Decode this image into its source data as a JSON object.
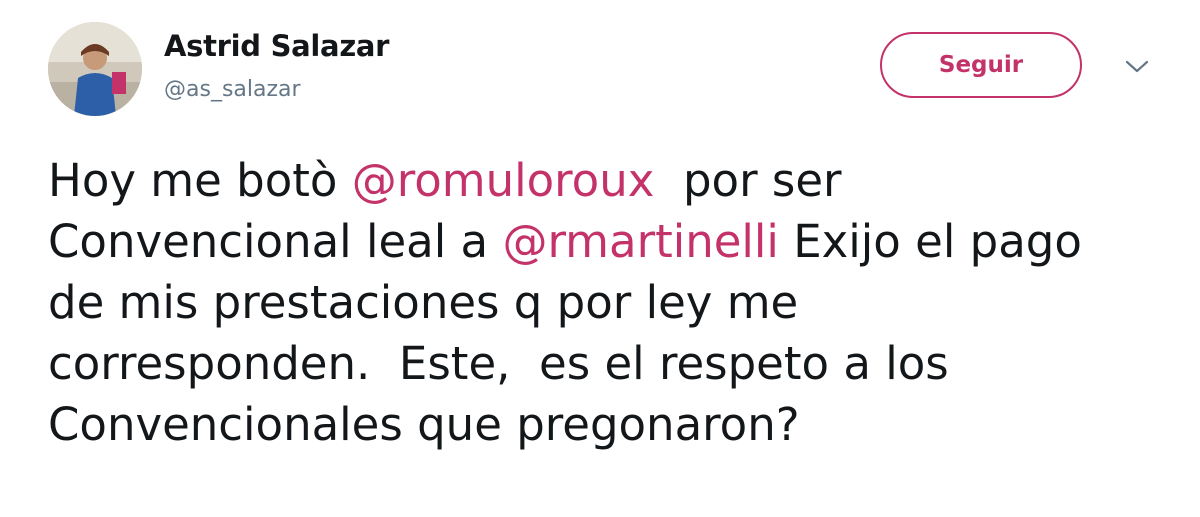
{
  "user": {
    "display_name": "Astrid Salazar",
    "handle": "@as_salazar",
    "avatar_icon": "profile-photo"
  },
  "actions": {
    "follow_label": "Seguir",
    "more_icon": "chevron-down-icon"
  },
  "tweet": {
    "line1_pre": "Hoy me botò ",
    "mention1": "@romuloroux",
    "line1_post": "  por ser\nConvencional leal a ",
    "mention2": "@rmartinelli",
    "text_after": " Exijo el pago\nde mis prestaciones q por ley me\ncorresponden.  Este,  es el respeto a los\nConvencionales que pregonaron?"
  },
  "colors": {
    "accent": "#c4326a",
    "text": "#14171a",
    "secondary": "#657786"
  }
}
